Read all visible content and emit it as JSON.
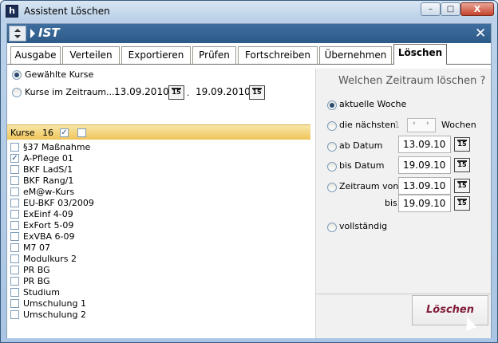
{
  "window": {
    "title": "Assistent Löschen",
    "min_glyph": "–",
    "max_glyph": "□",
    "close_glyph": "X"
  },
  "header": {
    "title": "IST",
    "close_glyph": "✕"
  },
  "tabs": [
    {
      "label": "Ausgabe"
    },
    {
      "label": "Verteilen"
    },
    {
      "label": "Exportieren"
    },
    {
      "label": "Prüfen"
    },
    {
      "label": "Fortschreiben"
    },
    {
      "label": "Übernehmen"
    },
    {
      "label": "Löschen"
    }
  ],
  "active_tab": "Löschen",
  "left": {
    "option1": "Gewählte Kurse",
    "option2": "Kurse im Zeitraum...",
    "date_from": "13.09.2010",
    "date_sep": ".",
    "date_to": "19.09.2010",
    "cal_glyph": "15",
    "selected_option": "Gewählte Kurse",
    "courses_label": "Kurse",
    "courses_count": "16",
    "courses": [
      {
        "name": "§37 Maßnahme",
        "checked": false
      },
      {
        "name": "A-Pflege 01",
        "checked": true
      },
      {
        "name": "BKF LadS/1",
        "checked": false
      },
      {
        "name": "BKF Rang/1",
        "checked": false
      },
      {
        "name": "eM@w-Kurs",
        "checked": false
      },
      {
        "name": "EU-BKF 03/2009",
        "checked": false
      },
      {
        "name": "ExEinf 4-09",
        "checked": false
      },
      {
        "name": "ExFort 5-09",
        "checked": false
      },
      {
        "name": "ExVBA 6-09",
        "checked": false
      },
      {
        "name": "M7 07",
        "checked": false
      },
      {
        "name": "Modulkurs 2",
        "checked": false
      },
      {
        "name": "PR BG",
        "checked": false
      },
      {
        "name": "PR BG",
        "checked": false
      },
      {
        "name": "Studium",
        "checked": false
      },
      {
        "name": "Umschulung 1",
        "checked": false
      },
      {
        "name": "Umschulung 2",
        "checked": false
      }
    ]
  },
  "right": {
    "question": "Welchen Zeitraum löschen ?",
    "opt_current_week": "aktuelle Woche",
    "opt_next": "die nächsten",
    "next_value": "1",
    "weeks": "Wochen",
    "opt_from_date": "ab Datum",
    "from_date": "13.09.10",
    "opt_to_date": "bis Datum",
    "to_date": "19.09.10",
    "opt_range": "Zeitraum von",
    "range_from": "13.09.10",
    "range_bis": "bis",
    "range_to": "19.09.10",
    "opt_complete": "vollständig",
    "selected": "aktuelle Woche",
    "delete_button": "Löschen",
    "cal_glyph": "15"
  }
}
